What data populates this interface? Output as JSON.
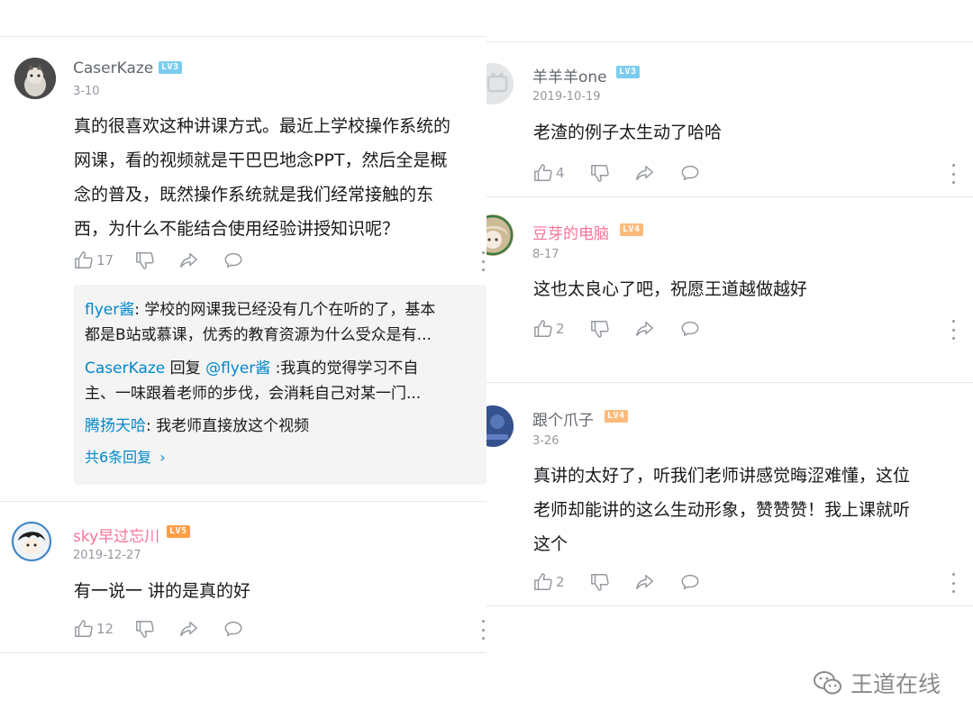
{
  "left": {
    "comments": [
      {
        "username": "CaserKaze",
        "level": "LV3",
        "level_color": "#7bcdef",
        "date": "3-10",
        "text_lines": [
          "真的很喜欢这种讲课方式。最近上学校操作系统的",
          "网课，看的视频就是干巴巴地念PPT，然后全是概",
          "念的普及，既然操作系统就是我们经常接触的东",
          "西，为什么不能结合使用经验讲授知识呢？"
        ],
        "likes": "17",
        "replies": [
          {
            "author": "flyer酱",
            "sep": ":",
            "line1": " 学校的网课我已经没有几个在听的了，基本",
            "line2": "都是B站或慕课，优秀的教育资源为什么受众是有..."
          },
          {
            "author": "CaserKaze",
            "mid": " 回复 ",
            "mention": "@flyer酱",
            "line1": " :我真的觉得学习不自",
            "line2": "主、一味跟着老师的步伐，会消耗自己对某一门..."
          },
          {
            "author": "腾扬天哈",
            "sep": ":",
            "line1": " 我老师直接放这个视频"
          }
        ],
        "reply_count_label": "共6条回复"
      },
      {
        "username": "sky早过忘川",
        "level": "LV5",
        "level_color": "#ff9e47",
        "date": "2019-12-27",
        "text_lines": [
          "有一说一 讲的是真的好"
        ],
        "likes": "12"
      }
    ]
  },
  "right": {
    "comments": [
      {
        "username": "羊羊羊one",
        "level": "LV3",
        "level_color": "#7bcdef",
        "date": "2019-10-19",
        "text_lines": [
          "老渣的例子太生动了哈哈"
        ],
        "likes": "4"
      },
      {
        "username": "豆芽的电脑",
        "level": "LV4",
        "level_color": "#feba7b",
        "date": "8-17",
        "text_lines": [
          "这也太良心了吧，祝愿王道越做越好"
        ],
        "likes": "2"
      },
      {
        "username": "跟个爪子",
        "level": "LV4",
        "level_color": "#feba7b",
        "date": "3-26",
        "text_lines": [
          "真讲的太好了，听我们老师讲感觉晦涩难懂，这位",
          "老师却能讲的这么生动形象，赞赞赞！我上课就听",
          "这个"
        ],
        "likes": "2"
      }
    ]
  },
  "watermark": {
    "text": "王道在线",
    "icon": "wechat-icon"
  },
  "icons": [
    "thumb-up-icon",
    "thumb-down-icon",
    "share-icon",
    "reply-bubble-icon",
    "more-vertical-icon"
  ],
  "colors": {
    "pink_name": "#fb7299",
    "grey_name": "#61666d",
    "link_blue": "#0088cc",
    "meta_grey": "#9499a0"
  }
}
